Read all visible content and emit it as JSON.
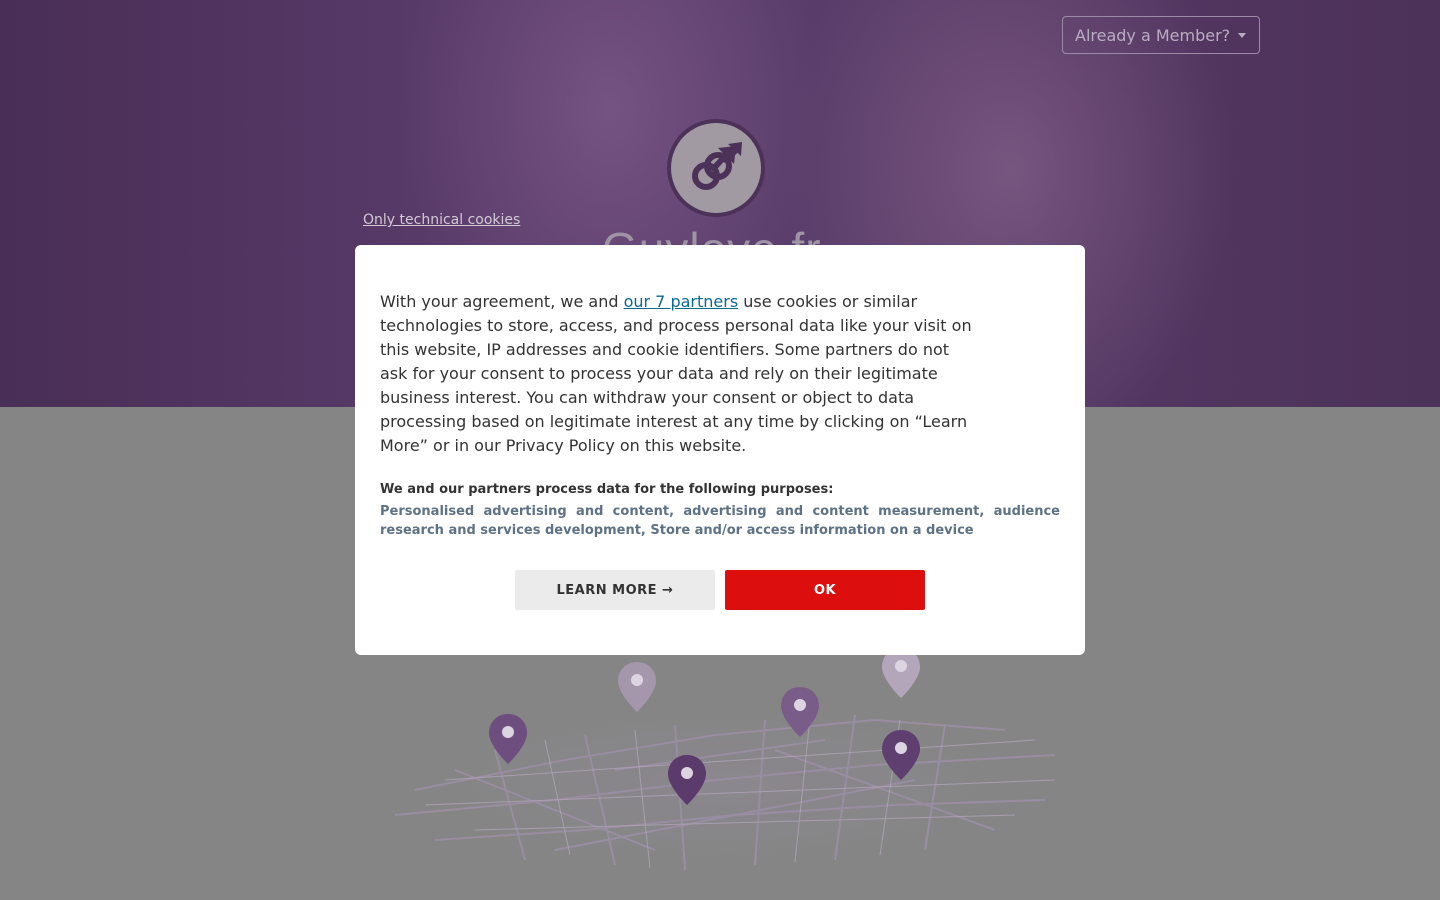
{
  "header": {
    "member_button_label": "Already a Member?",
    "site_title": "Guylove.fr",
    "technical_cookies_link": "Only technical cookies"
  },
  "consent": {
    "text_before_link": "With your agreement, we and ",
    "partners_link": "our 7 partners",
    "text_after_link": " use cookies or similar technologies to store, access, and process personal data like your visit on this website, IP addresses and cookie identifiers. Some partners do not ask for your consent to process your data and rely on their legitimate business interest. You can withdraw your consent or object to data processing based on legitimate interest at any time by clicking on “Learn More” or in our Privacy Policy on this website.",
    "purposes_title": "We and our partners process data for the following purposes:",
    "purposes_list": "Personalised advertising and content, advertising and content measurement, audience research and services development, Store and/or access information on a device",
    "learn_more_label": "LEARN MORE →",
    "ok_label": "OK"
  },
  "colors": {
    "brand_purple": "#5a3d6a",
    "ok_button": "#dd0e0e",
    "link": "#0b6b8f"
  },
  "icons": {
    "logo": "male-male-symbol-icon",
    "map_pin": "map-pin-icon"
  }
}
